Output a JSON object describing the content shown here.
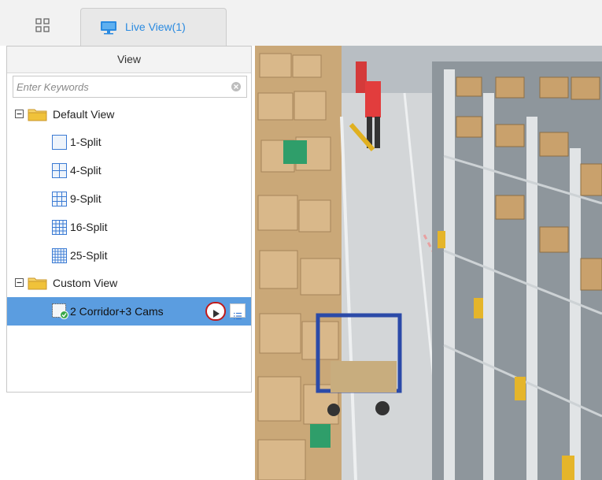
{
  "tabs": {
    "live_view_label": "Live View(1)"
  },
  "panel": {
    "title": "View",
    "search": {
      "placeholder": "Enter Keywords",
      "value": ""
    }
  },
  "tree": {
    "default_view": {
      "label": "Default View",
      "items": [
        "1-Split",
        "4-Split",
        "9-Split",
        "16-Split",
        "25-Split"
      ]
    },
    "custom_view": {
      "label": "Custom View",
      "items": [
        "2 Corridor+3 Cams"
      ]
    }
  },
  "colors": {
    "accent_blue": "#2a8ae0",
    "selected_row": "#5b9de0",
    "highlight_ring": "#c01a1a",
    "folder": "#f0c23a",
    "split_icon": "#3b7bd4"
  },
  "icons": {
    "tab_home": "grid-icon",
    "tab_live": "monitor-icon",
    "clear": "clear-icon",
    "folder": "folder-icon",
    "play": "play-icon",
    "list": "list-icon"
  }
}
